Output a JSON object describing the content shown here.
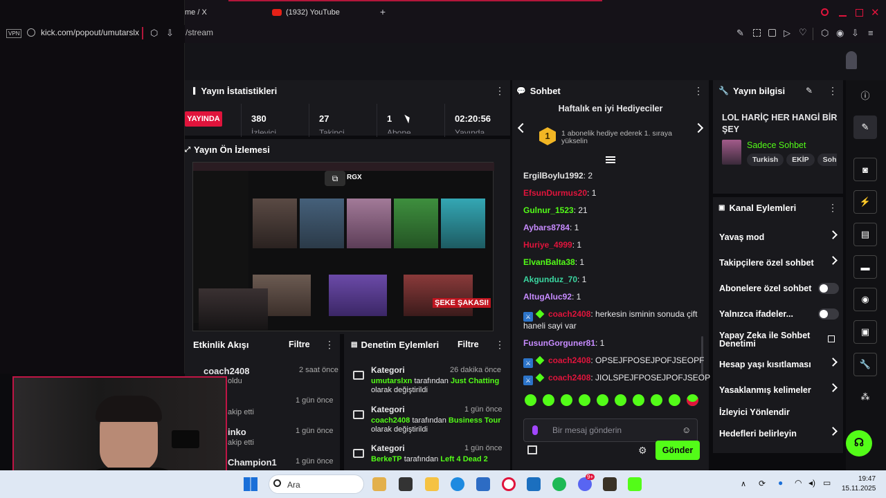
{
  "browser": {
    "tab1_title": "me / X",
    "tab2_title": "(1932) YouTube",
    "popup_url": "kick.com/popout/umutarslx",
    "main_url_fragment": "/stream",
    "vpn_label": "VPN"
  },
  "stats": {
    "header": "Yayın İstatistikleri",
    "live_label": "YAYINDA",
    "items": [
      {
        "value": "380",
        "label": "İzleyici"
      },
      {
        "value": "27",
        "label": "Takipçi"
      },
      {
        "value": "1",
        "label": "Abone"
      },
      {
        "value": "02:20:56",
        "label": "Yayında"
      }
    ]
  },
  "preview": {
    "header": "Yayın Ön İzlemesi",
    "overlay_text": "RGX",
    "thumb_caption": "ŞEKE ŞAKASI!"
  },
  "activity": {
    "header": "Etkinlik Akışı",
    "filter_label": "Filtre",
    "items": [
      {
        "user": "coach2408",
        "action": "oldu",
        "time": "2 saat önce"
      },
      {
        "user": "",
        "action": "akip etti",
        "time": "1 gün önce"
      },
      {
        "user": "inko",
        "action": "akip etti",
        "time": "1 gün önce"
      },
      {
        "user": "Champion1",
        "action": "",
        "time": "1 gün önce"
      }
    ]
  },
  "moderation": {
    "header": "Denetim Eylemleri",
    "filter_label": "Filtre",
    "items": [
      {
        "title": "Kategori",
        "time": "26 dakika önce",
        "user": "umutarslxn",
        "mid": " tarafından ",
        "target": "Just Chatting",
        "tail": "olarak değiştirildi"
      },
      {
        "title": "Kategori",
        "time": "1 gün önce",
        "user": "coach2408",
        "mid": " tarafından ",
        "target": "Business Tour",
        "tail": "olarak değiştirildi"
      },
      {
        "title": "Kategori",
        "time": "1 gün önce",
        "user": "BerkeTP",
        "mid": " tarafından ",
        "target": "Left 4 Dead 2",
        "tail": ""
      }
    ]
  },
  "chat": {
    "header": "Sohbet",
    "gifters_title": "Haftalık en iyi Hediyeciler",
    "gifter_rank": "1",
    "gifter_text": "1 abonelik hediye ederek 1. sıraya yükselin",
    "messages": [
      {
        "user": "ErgilBoylu1992",
        "color": "#e6e6e6",
        "text": ": 2"
      },
      {
        "user": "EfsunDurmus20",
        "color": "#e0143c",
        "text": ": 1"
      },
      {
        "user": "Gulnur_1523",
        "color": "#53fc18",
        "text": ": 21"
      },
      {
        "user": "Aybars8784",
        "color": "#c78bff",
        "text": ": 1"
      },
      {
        "user": "Huriye_4999",
        "color": "#e0143c",
        "text": ": 1"
      },
      {
        "user": "ElvanBalta38",
        "color": "#53fc18",
        "text": ": 1"
      },
      {
        "user": "Akgunduz_70",
        "color": "#3ad6a0",
        "text": ": 1"
      },
      {
        "user": "AltugAluc92",
        "color": "#c78bff",
        "text": ": 1"
      }
    ],
    "mod_msg1_user": "coach2408",
    "mod_msg1_text": ": herkesin isminin sonuda çift",
    "mod_msg1_text2": "haneli sayi var",
    "msg_fusun_user": "FusunGorguner81",
    "msg_fusun_text": ": 1",
    "mod_msg2_user": "coach2408",
    "mod_msg2_text": ": OPSEJFPOSEJPOFJSEOPF",
    "mod_msg3_user": "coach2408",
    "mod_msg3_text": ": JIOLSPEJFPOSEJPOFJSEOP",
    "input_placeholder": "Bir mesaj gönderin",
    "send_label": "Gönder"
  },
  "stream_info": {
    "header": "Yayın bilgisi",
    "title": "LOL HARİÇ HER HANGİ BİR ŞEY",
    "category": "Sadece Sohbet",
    "tags": [
      "Turkish",
      "EKİP",
      "Sohb"
    ]
  },
  "channel_actions": {
    "header": "Kanal Eylemleri",
    "items": [
      {
        "label": "Yavaş mod",
        "kind": "chevron"
      },
      {
        "label": "Takipçilere özel sohbet",
        "kind": "chevron"
      },
      {
        "label": "Abonelere özel sohbet",
        "kind": "toggle"
      },
      {
        "label": "Yalnızca ifadeler...",
        "kind": "toggle"
      },
      {
        "label": "Yapay Zeka ile Sohbet Denetimi",
        "kind": "external"
      },
      {
        "label": "Hesap yaşı kısıtlaması",
        "kind": "chevron"
      },
      {
        "label": "Yasaklanmış kelimeler",
        "kind": "chevron"
      },
      {
        "label": "İzleyici Yönlendir",
        "kind": "none"
      },
      {
        "label": "Hedefleri belirleyin",
        "kind": "chevron"
      }
    ]
  },
  "taskbar": {
    "search_placeholder": "Ara",
    "time": "19:47",
    "date": "15.11.2025",
    "notif_count": "9+"
  },
  "colors": {
    "kick_green": "#53fc18",
    "live_red": "#e0143c",
    "panel": "#19191d"
  }
}
